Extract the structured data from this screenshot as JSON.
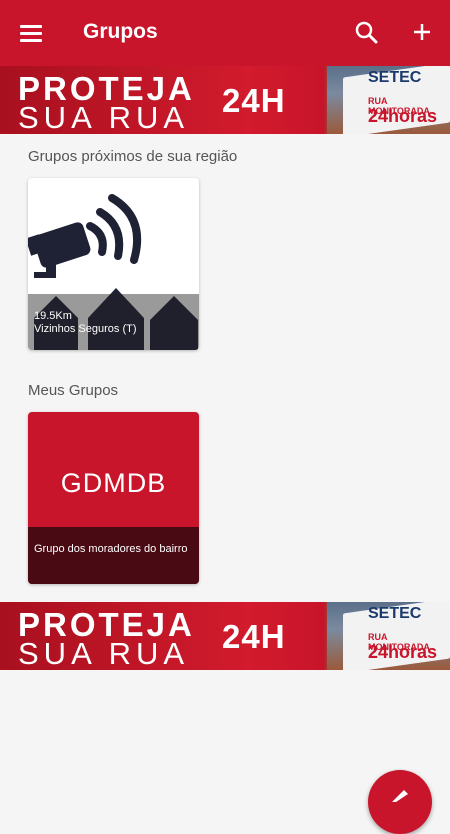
{
  "appbar": {
    "title": "Grupos",
    "menu_icon": "menu-icon",
    "search_icon": "search-icon",
    "add_icon": "plus-icon",
    "color": "#c8152c"
  },
  "banner": {
    "line1": "PROTEJA",
    "line2": "SUA RUA",
    "line3": "24H",
    "brand": "SETEC",
    "monitored": "RUA MONITORADA",
    "hours": "24horas"
  },
  "sections": {
    "nearby": "Grupos próximos de sua região",
    "mine": "Meus Grupos"
  },
  "nearby_groups": [
    {
      "distance": "19.5Km",
      "name": "Vizinhos Seguros (T)"
    }
  ],
  "my_groups": [
    {
      "code": "GDMDB",
      "description": "Grupo dos moradores do bairro"
    }
  ],
  "fab": {
    "icon": "edit-icon"
  }
}
